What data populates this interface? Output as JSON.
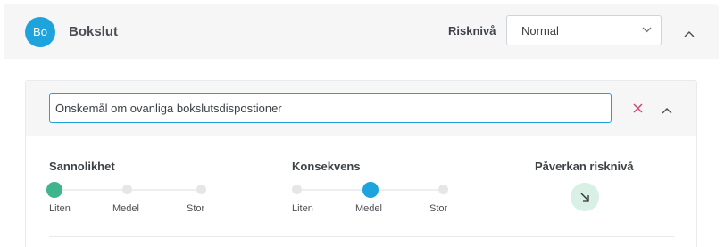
{
  "header": {
    "avatar_initials": "Bo",
    "title": "Bokslut",
    "risk_label": "Risknivå",
    "risk_select": {
      "selected": "Normal"
    },
    "avatar_color": "#1ea3dd"
  },
  "card": {
    "input_value": "Önskemål om ovanliga bokslutsdispostioner",
    "probability": {
      "title": "Sannolikhet",
      "options": [
        "Liten",
        "Medel",
        "Stor"
      ],
      "selected": "Liten",
      "color": "#3fb58c"
    },
    "consequence": {
      "title": "Konsekvens",
      "options": [
        "Liten",
        "Medel",
        "Stor"
      ],
      "selected": "Medel",
      "color": "#1ea3dd"
    },
    "impact": {
      "title": "Påverkan risknivå",
      "icon": "arrow-down-right-icon",
      "color": "#d9f0e6"
    }
  },
  "icons": {
    "header_collapse": "chevron-up-icon",
    "select_dropdown": "chevron-down-icon",
    "clear": "close-icon",
    "card_collapse": "chevron-up-icon"
  }
}
